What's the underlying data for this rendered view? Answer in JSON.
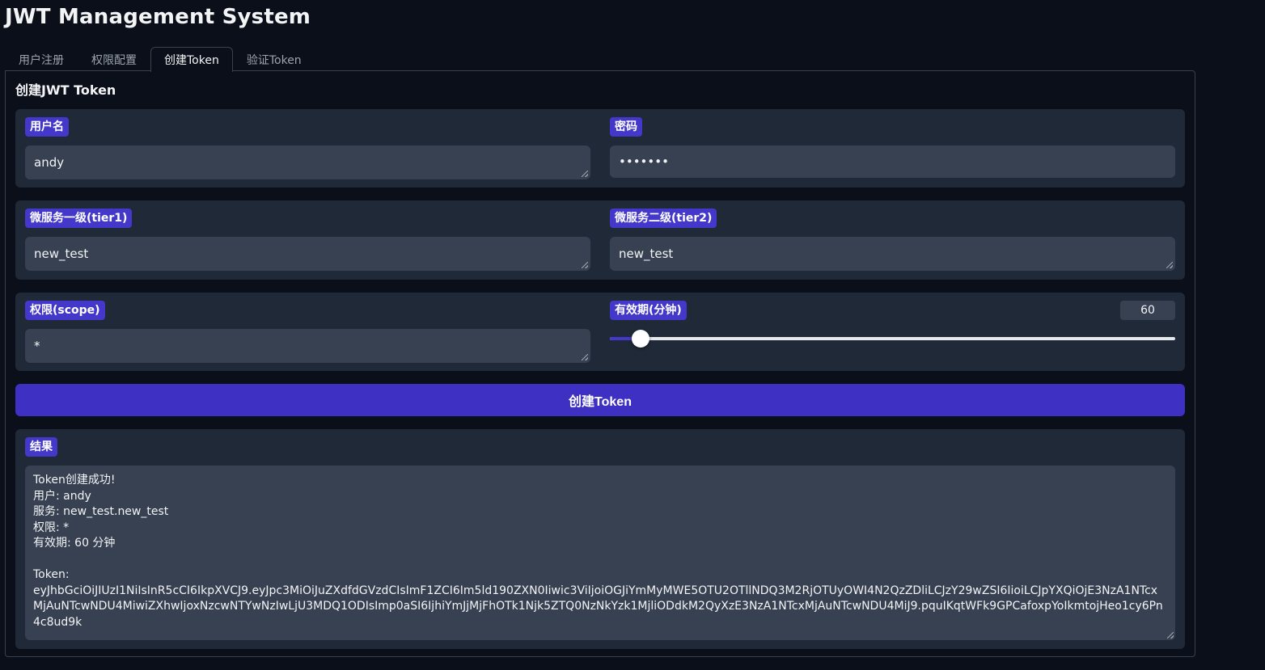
{
  "app": {
    "title": "JWT Management System"
  },
  "tabs": [
    {
      "label": "用户注册",
      "active": false
    },
    {
      "label": "权限配置",
      "active": false
    },
    {
      "label": "创建Token",
      "active": true
    },
    {
      "label": "验证Token",
      "active": false
    }
  ],
  "panel": {
    "title": "创建JWT Token"
  },
  "form": {
    "username": {
      "label": "用户名",
      "value": "andy"
    },
    "password": {
      "label": "密码",
      "value": "•••••••"
    },
    "tier1": {
      "label": "微服务一级(tier1)",
      "value": "new_test"
    },
    "tier2": {
      "label": "微服务二级(tier2)",
      "value": "new_test"
    },
    "scope": {
      "label": "权限(scope)",
      "value": "*"
    },
    "expiry": {
      "label": "有效期(分钟)",
      "value": "60",
      "fraction": 0.054
    }
  },
  "actions": {
    "create_label": "创建Token"
  },
  "result": {
    "label": "结果",
    "lines": [
      "Token创建成功!",
      "用户: andy",
      "服务: new_test.new_test",
      "权限: *",
      "有效期: 60 分钟",
      "",
      "Token:"
    ],
    "token": "eyJhbGciOiJIUzI1NiIsInR5cCI6IkpXVCJ9.eyJpc3MiOiJuZXdfdGVzdCIsImF1ZCI6Im5ld190ZXN0Iiwic3ViIjoiOGJiYmMyMWE5OTU2OTllNDQ3M2RjOTUyOWI4N2QzZDliLCJzY29wZSI6IioiLCJpYXQiOjE3NzA1NTcxMjAuNTcwNDU4MiwiZXhwIjoxNzcwNTYwNzIwLjU3MDQ1ODIsImp0aSI6IjhiYmJjMjFhOTk1Njk5ZTQ0NzNkYzk1MjliODdkM2QyXzE3NzA1NTcxMjAuNTcwNDU4MiJ9.pquIKqtWFk9GPCafoxpYoIkmtojHeo1cy6Pn4c8ud9k"
  },
  "colors": {
    "background": "#0b0f19",
    "row": "#1f2937",
    "input": "#374151",
    "accent": "#4338ca",
    "button": "#3f30c4"
  }
}
